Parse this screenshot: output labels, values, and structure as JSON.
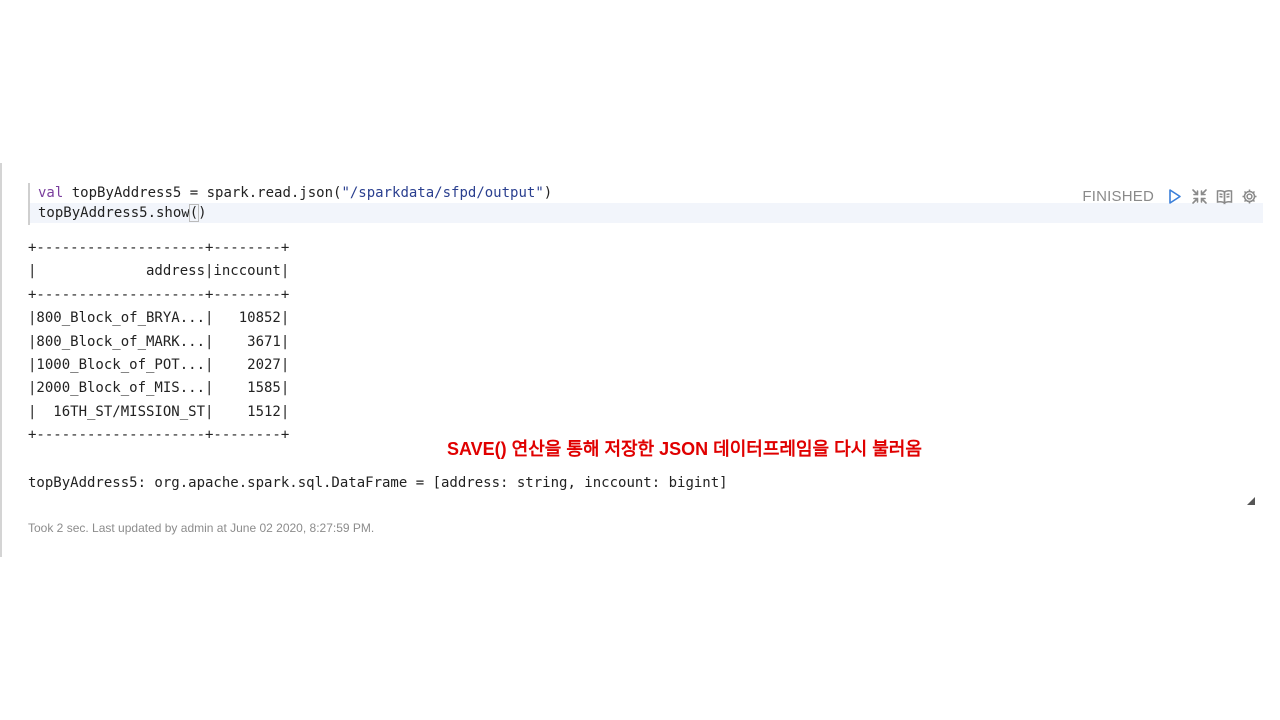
{
  "code": {
    "line1_keyword": "val",
    "line1_pre": " topByAddress5 = spark.read.json(",
    "line1_string": "\"/sparkdata/sfpd/output\"",
    "line1_post": ")",
    "line2_pre": "topByAddress5.show",
    "line2_paren_open": "(",
    "line2_paren_close": ")"
  },
  "status": {
    "label": "FINISHED",
    "icons": [
      "run-icon",
      "shrink-icon",
      "book-icon",
      "gear-icon"
    ]
  },
  "output": {
    "table_text": "+--------------------+--------+\n|             address|inccount|\n+--------------------+--------+\n|800_Block_of_BRYA...|   10852|\n|800_Block_of_MARK...|    3671|\n|1000_Block_of_POT...|    2027|\n|2000_Block_of_MIS...|    1585|\n|  16TH_ST/MISSION_ST|    1512|\n+--------------------+--------+",
    "header": [
      "address",
      "inccount"
    ],
    "rows": [
      [
        "800_Block_of_BRYA...",
        "10852"
      ],
      [
        "800_Block_of_MARK...",
        "3671"
      ],
      [
        "1000_Block_of_POT...",
        "2027"
      ],
      [
        "2000_Block_of_MIS...",
        "1585"
      ],
      [
        "16TH_ST/MISSION_ST",
        "1512"
      ]
    ],
    "result_line": "topByAddress5: org.apache.spark.sql.DataFrame = [address: string, inccount: bigint]"
  },
  "annotation": {
    "text": "SAVE() 연산을 통해 저장한 JSON 데이터프레임을 다시 불러옴",
    "color": "#e00000"
  },
  "footer": {
    "text": "Took 2 sec. Last updated by admin at June 02 2020, 8:27:59 PM."
  },
  "colors": {
    "status_gray": "#8a8a8a",
    "icon_blue": "#3b7fd9",
    "active_line_bg": "#f2f5fb"
  }
}
